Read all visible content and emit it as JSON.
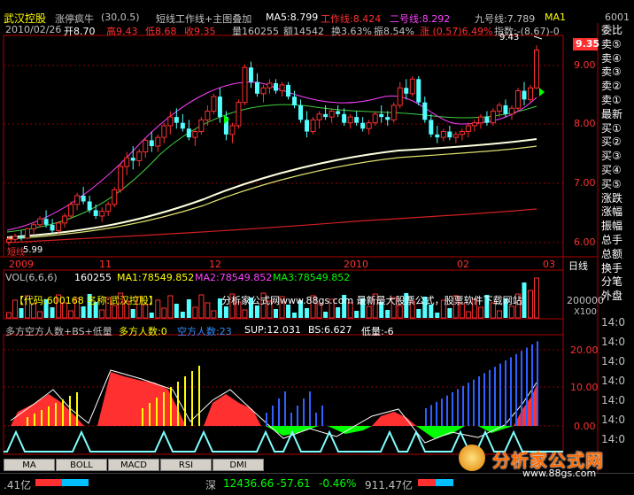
{
  "header": {
    "stock_name": "武汉控股",
    "formula": "涨停疯牛",
    "params": "(30,0.5)",
    "overlay_title": "短线工作线+主图叠加",
    "ma5": "MA5:8.799",
    "work_line": "工作线:8.424",
    "line2": "二号线:8.292",
    "line9": "九号线:7.789",
    "ma_tag": "MA1",
    "code_partial": "6001"
  },
  "quote": {
    "date": "2010/02/26",
    "open": "开8.70",
    "high": "高9.43",
    "low": "低8.68",
    "close": "收9.35",
    "volume": "量160255",
    "amount": "额14542",
    "turnover": "换3.63%",
    "amplitude": "振8.54%",
    "change": "涨 (0.57)6.49%",
    "index": "指数:-(8.67)-0"
  },
  "price_axis": {
    "labels": [
      "9.00",
      "8.00",
      "7.00",
      "6.00"
    ],
    "current": "9.35",
    "high_mark": "9.43",
    "low_mark": "5.99",
    "watermark": "短线"
  },
  "time_axis": {
    "labels": [
      "2009",
      "11",
      "12",
      "2010",
      "02",
      "03"
    ],
    "period": "日线"
  },
  "volume_panel": {
    "title": "VOL(6,6,6)",
    "value": "160255",
    "ma1": "MA1:78549.852",
    "ma2": "MA2:78549.852",
    "ma3": "MA3:78549.852",
    "banner": "【代码:600168 名称:武汉控股】",
    "site_banner": "分析家公式网www.88gs.com 最新最大股票公式，股票软件下载网站",
    "axis_label": "200000",
    "axis_unit": "X100"
  },
  "indicator_panel": {
    "title": "多方空方人数+BS+低量",
    "bull": "多方人数:0",
    "bear": "空方人数:23",
    "sup": "SUP:12.031",
    "bs": "BS:6.627",
    "low_vol": "低量:-6",
    "axis_labels": [
      "20.00",
      "10.00",
      "0.00"
    ]
  },
  "tabs": [
    "MA",
    "BOLL",
    "MACD",
    "RSI",
    "DMI"
  ],
  "sidebar": {
    "items": [
      {
        "label": "委比",
        "color": "#ffffff"
      },
      {
        "label": "卖⑤",
        "color": "#ffffff"
      },
      {
        "label": "卖④",
        "color": "#ffffff"
      },
      {
        "label": "卖③",
        "color": "#ffffff"
      },
      {
        "label": "卖②",
        "color": "#ffffff"
      },
      {
        "label": "卖①",
        "color": "#ffffff"
      },
      {
        "label": "最新",
        "color": "#ffffff"
      },
      {
        "label": "买①",
        "color": "#ffffff"
      },
      {
        "label": "买②",
        "color": "#ffffff"
      },
      {
        "label": "买③",
        "color": "#ffffff"
      },
      {
        "label": "买④",
        "color": "#ffffff"
      },
      {
        "label": "买⑤",
        "color": "#ffffff"
      },
      {
        "label": "涨跌",
        "color": "#ffffff"
      },
      {
        "label": "涨幅",
        "color": "#ffffff"
      },
      {
        "label": "振幅",
        "color": "#ffffff"
      },
      {
        "label": "总手",
        "color": "#ffffff"
      },
      {
        "label": "总额",
        "color": "#ffffff"
      },
      {
        "label": "换手",
        "color": "#ffffff"
      },
      {
        "label": "分笔",
        "color": "#ffffff"
      },
      {
        "label": "外盘",
        "color": "#ffffff"
      }
    ],
    "times": [
      "14:0",
      "14:0",
      "14:0",
      "14:0",
      "14:0",
      "14:0",
      "14:0"
    ]
  },
  "status": {
    "left_value": ".41亿",
    "market": "深",
    "index": "12436.66",
    "change": "-57.61",
    "pct": "-0.46%",
    "amount": "911.47亿"
  },
  "watermark": {
    "brand": "分析家公式网",
    "url": "www.88gs.com"
  },
  "colors": {
    "up": "#ff3030",
    "down": "#54ffff",
    "yellow": "#ffff00",
    "magenta": "#ff40ff",
    "green": "#00ff00",
    "blue": "#3060ff",
    "frame": "#b00000"
  },
  "chart_data": {
    "type": "candlestick",
    "ylim": [
      5.8,
      9.6
    ],
    "candles": [
      [
        6.05,
        6.15,
        5.99,
        6.1
      ],
      [
        6.1,
        6.2,
        6.05,
        6.15
      ],
      [
        6.15,
        6.25,
        6.08,
        6.12
      ],
      [
        6.12,
        6.3,
        6.1,
        6.28
      ],
      [
        6.28,
        6.4,
        6.2,
        6.35
      ],
      [
        6.35,
        6.5,
        6.3,
        6.45
      ],
      [
        6.45,
        6.6,
        6.3,
        6.35
      ],
      [
        6.35,
        6.45,
        6.2,
        6.25
      ],
      [
        6.25,
        6.4,
        6.2,
        6.38
      ],
      [
        6.38,
        6.55,
        6.3,
        6.5
      ],
      [
        6.5,
        6.75,
        6.45,
        6.7
      ],
      [
        6.7,
        6.9,
        6.6,
        6.85
      ],
      [
        6.85,
        7.0,
        6.7,
        6.75
      ],
      [
        6.75,
        6.85,
        6.55,
        6.6
      ],
      [
        6.6,
        6.7,
        6.45,
        6.5
      ],
      [
        6.5,
        6.65,
        6.4,
        6.58
      ],
      [
        6.58,
        6.75,
        6.5,
        6.7
      ],
      [
        6.7,
        7.0,
        6.65,
        6.95
      ],
      [
        6.95,
        7.4,
        6.9,
        7.35
      ],
      [
        7.35,
        7.6,
        7.2,
        7.5
      ],
      [
        7.5,
        7.7,
        7.3,
        7.45
      ],
      [
        7.45,
        7.65,
        7.35,
        7.6
      ],
      [
        7.6,
        7.85,
        7.5,
        7.8
      ],
      [
        7.8,
        7.95,
        7.6,
        7.7
      ],
      [
        7.7,
        7.9,
        7.6,
        7.85
      ],
      [
        7.85,
        8.1,
        7.75,
        8.05
      ],
      [
        8.05,
        8.3,
        7.9,
        8.2
      ],
      [
        8.2,
        8.35,
        8.0,
        8.1
      ],
      [
        8.1,
        8.25,
        7.95,
        8.0
      ],
      [
        8.0,
        8.15,
        7.8,
        7.85
      ],
      [
        7.85,
        8.0,
        7.7,
        7.95
      ],
      [
        7.95,
        8.2,
        7.9,
        8.15
      ],
      [
        8.15,
        8.4,
        8.05,
        8.3
      ],
      [
        8.3,
        8.6,
        8.25,
        8.55
      ],
      [
        8.55,
        8.7,
        8.1,
        8.2
      ],
      [
        8.2,
        8.3,
        7.8,
        7.9
      ],
      [
        7.9,
        8.1,
        7.75,
        8.05
      ],
      [
        8.05,
        8.5,
        8.0,
        8.45
      ],
      [
        8.45,
        9.1,
        8.4,
        9.05
      ],
      [
        9.05,
        9.15,
        8.7,
        8.8
      ],
      [
        8.8,
        8.95,
        8.55,
        8.6
      ],
      [
        8.6,
        8.75,
        8.45,
        8.7
      ],
      [
        8.7,
        8.85,
        8.6,
        8.78
      ],
      [
        8.78,
        8.85,
        8.6,
        8.65
      ],
      [
        8.65,
        8.8,
        8.55,
        8.75
      ],
      [
        8.75,
        8.8,
        8.5,
        8.55
      ],
      [
        8.55,
        8.65,
        8.35,
        8.4
      ],
      [
        8.4,
        8.5,
        8.1,
        8.15
      ],
      [
        8.15,
        8.3,
        7.85,
        7.95
      ],
      [
        7.95,
        8.2,
        7.9,
        8.15
      ],
      [
        8.15,
        8.3,
        8.0,
        8.25
      ],
      [
        8.25,
        8.4,
        8.15,
        8.2
      ],
      [
        8.2,
        8.35,
        8.1,
        8.3
      ],
      [
        8.3,
        8.4,
        8.2,
        8.25
      ],
      [
        8.25,
        8.35,
        8.05,
        8.1
      ],
      [
        8.1,
        8.25,
        8.0,
        8.2
      ],
      [
        8.2,
        8.3,
        8.05,
        8.1
      ],
      [
        8.1,
        8.2,
        7.95,
        8.0
      ],
      [
        8.0,
        8.15,
        7.9,
        8.1
      ],
      [
        8.1,
        8.3,
        8.05,
        8.25
      ],
      [
        8.25,
        8.4,
        8.1,
        8.2
      ],
      [
        8.2,
        8.3,
        8.05,
        8.15
      ],
      [
        8.15,
        8.45,
        8.1,
        8.4
      ],
      [
        8.4,
        8.8,
        8.35,
        8.7
      ],
      [
        8.7,
        8.85,
        8.5,
        8.6
      ],
      [
        8.6,
        8.9,
        8.55,
        8.85
      ],
      [
        8.85,
        8.9,
        8.4,
        8.45
      ],
      [
        8.45,
        8.55,
        8.1,
        8.15
      ],
      [
        8.15,
        8.25,
        7.85,
        7.9
      ],
      [
        7.9,
        8.05,
        7.75,
        7.85
      ],
      [
        7.85,
        8.0,
        7.78,
        7.95
      ],
      [
        7.95,
        8.05,
        7.8,
        7.85
      ],
      [
        7.85,
        7.95,
        7.75,
        7.9
      ],
      [
        7.9,
        8.0,
        7.8,
        7.95
      ],
      [
        7.95,
        8.1,
        7.85,
        8.05
      ],
      [
        8.05,
        8.15,
        7.95,
        8.1
      ],
      [
        8.1,
        8.25,
        8.0,
        8.2
      ],
      [
        8.2,
        8.3,
        8.05,
        8.1
      ],
      [
        8.1,
        8.35,
        8.05,
        8.3
      ],
      [
        8.3,
        8.45,
        8.2,
        8.4
      ],
      [
        8.4,
        8.5,
        8.2,
        8.25
      ],
      [
        8.25,
        8.4,
        8.15,
        8.35
      ],
      [
        8.35,
        8.7,
        8.3,
        8.65
      ],
      [
        8.65,
        8.8,
        8.4,
        8.5
      ],
      [
        8.5,
        8.75,
        8.45,
        8.7
      ],
      [
        8.7,
        9.43,
        8.68,
        9.35
      ]
    ]
  }
}
